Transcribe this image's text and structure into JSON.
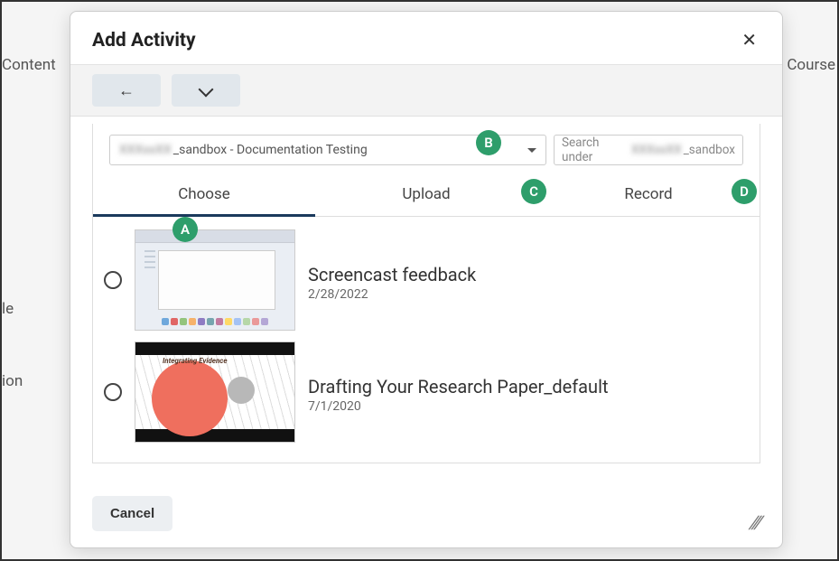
{
  "background": {
    "content": "Content",
    "course": "Course",
    "le": "le",
    "ion": "ion"
  },
  "modal": {
    "title": "Add Activity",
    "dropdown_prefix_masked": "XXXxxXX",
    "dropdown_suffix": "_sandbox - Documentation Testing",
    "search_prefix": "Search under ",
    "search_masked": "XXXxxXX",
    "search_suffix": "_sandbox",
    "tabs": {
      "choose": "Choose",
      "upload": "Upload",
      "record": "Record"
    },
    "items": [
      {
        "title": "Screencast feedback",
        "date": "2/28/2022"
      },
      {
        "title": "Drafting Your Research Paper_default",
        "date": "7/1/2020"
      }
    ],
    "thumb2_label": "Integrating Evidence",
    "cancel": "Cancel"
  },
  "badges": {
    "a": "A",
    "b": "B",
    "c": "C",
    "d": "D"
  }
}
